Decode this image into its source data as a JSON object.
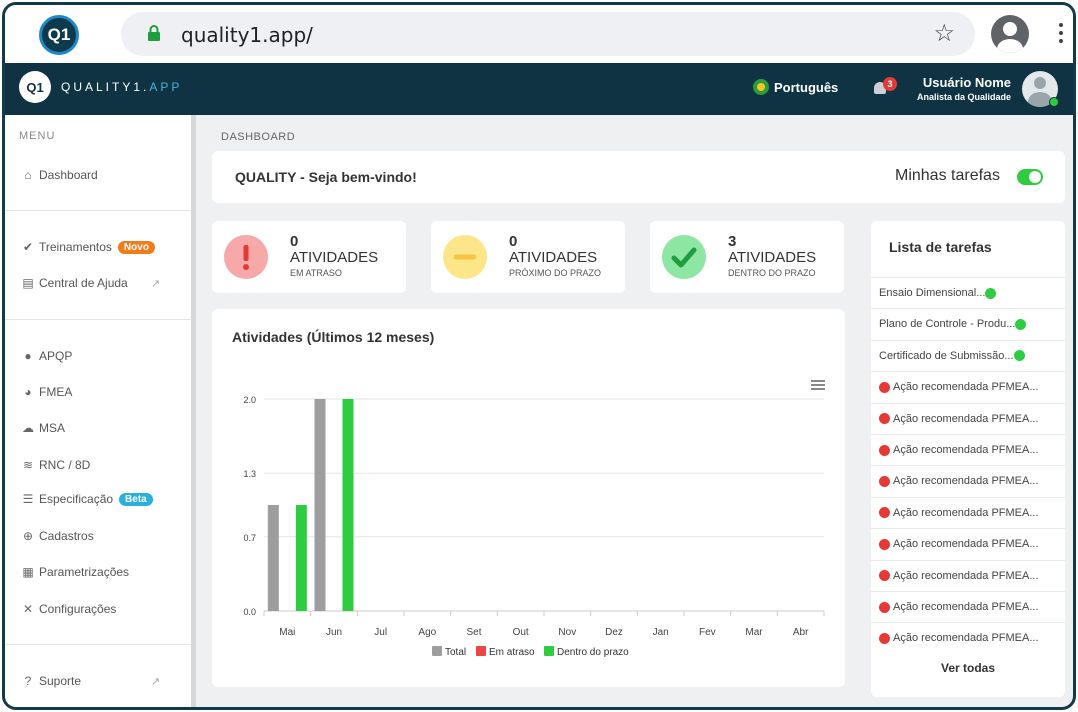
{
  "browser": {
    "logo_text": "Q1",
    "url": "quality1.app/"
  },
  "app": {
    "logo_text": "Q1",
    "brand_prefix": "QUALITY1.",
    "brand_suffix": "APP",
    "language": "Português",
    "notifications": "3",
    "user_name": "Usuário Nome",
    "user_role": "Analista da Qualidade"
  },
  "sidebar": {
    "menu_title": "MENU",
    "items": [
      {
        "label": "Dashboard",
        "icon": "home-icon"
      },
      {
        "label": "Treinamentos",
        "icon": "check-circle-icon",
        "badge": "Novo"
      },
      {
        "label": "Central de Ajuda",
        "icon": "book-icon"
      },
      {
        "label": "APQP",
        "icon": "globe-icon"
      },
      {
        "label": "FMEA",
        "icon": "pie-chart-icon"
      },
      {
        "label": "MSA",
        "icon": "cloud-icon"
      },
      {
        "label": "RNC / 8D",
        "icon": "layers-icon"
      },
      {
        "label": "Especificação",
        "icon": "list-icon",
        "badge": "Beta"
      },
      {
        "label": "Cadastros",
        "icon": "plus-circle-icon"
      },
      {
        "label": "Parametrizações",
        "icon": "grid-icon"
      },
      {
        "label": "Configurações",
        "icon": "tools-icon"
      },
      {
        "label": "Suporte",
        "icon": "question-icon"
      }
    ]
  },
  "main": {
    "breadcrumb": "DASHBOARD",
    "welcome": "QUALITY - Seja bem-vindo!",
    "my_tasks_label": "Minhas tarefas",
    "stats": [
      {
        "count": "0",
        "label": "ATIVIDADES",
        "sub": "EM ATRASO",
        "color": "#f7a9a9",
        "icon": "exclamation-icon"
      },
      {
        "count": "0",
        "label": "ATIVIDADES",
        "sub": "PRÓXIMO DO PRAZO",
        "color": "#fde68a",
        "icon": "minus-icon"
      },
      {
        "count": "3",
        "label": "ATIVIDADES",
        "sub": "DENTRO DO PRAZO",
        "color": "#8ee6a3",
        "icon": "check-icon"
      }
    ]
  },
  "chart_data": {
    "type": "bar",
    "title": "Atividades (Últimos 12 meses)",
    "categories": [
      "Mai",
      "Jun",
      "Jul",
      "Ago",
      "Set",
      "Out",
      "Nov",
      "Dez",
      "Jan",
      "Fev",
      "Mar",
      "Abr"
    ],
    "series": [
      {
        "name": "Total",
        "color": "#9e9e9e",
        "values": [
          1,
          2,
          0,
          0,
          0,
          0,
          0,
          0,
          0,
          0,
          0,
          0
        ]
      },
      {
        "name": "Em atraso",
        "color": "#ef4444",
        "values": [
          0,
          0,
          0,
          0,
          0,
          0,
          0,
          0,
          0,
          0,
          0,
          0
        ]
      },
      {
        "name": "Dentro do prazo",
        "color": "#2ecc40",
        "values": [
          1,
          2,
          0,
          0,
          0,
          0,
          0,
          0,
          0,
          0,
          0,
          0
        ]
      }
    ],
    "yticks": [
      "0.0",
      "0.7",
      "1.3",
      "2.0"
    ],
    "ylim": [
      0,
      2
    ],
    "legend": "bottom",
    "grid": true
  },
  "tasks": {
    "title": "Lista de tarefas",
    "items": [
      {
        "label": "Ensaio Dimensional...",
        "status": "green"
      },
      {
        "label": "Plano de Controle - Produ...",
        "status": "green"
      },
      {
        "label": "Certificado de Submissão...",
        "status": "green"
      },
      {
        "label": "Ação recomendada PFMEA...",
        "status": "red"
      },
      {
        "label": "Ação recomendada PFMEA...",
        "status": "red"
      },
      {
        "label": "Ação recomendada PFMEA...",
        "status": "red"
      },
      {
        "label": "Ação recomendada PFMEA...",
        "status": "red"
      },
      {
        "label": "Ação recomendada PFMEA...",
        "status": "red"
      },
      {
        "label": "Ação recomendada PFMEA...",
        "status": "red"
      },
      {
        "label": "Ação recomendada PFMEA...",
        "status": "red"
      },
      {
        "label": "Ação recomendada PFMEA...",
        "status": "red"
      },
      {
        "label": "Ação recomendada PFMEA...",
        "status": "red"
      }
    ],
    "see_all": "Ver todas"
  }
}
